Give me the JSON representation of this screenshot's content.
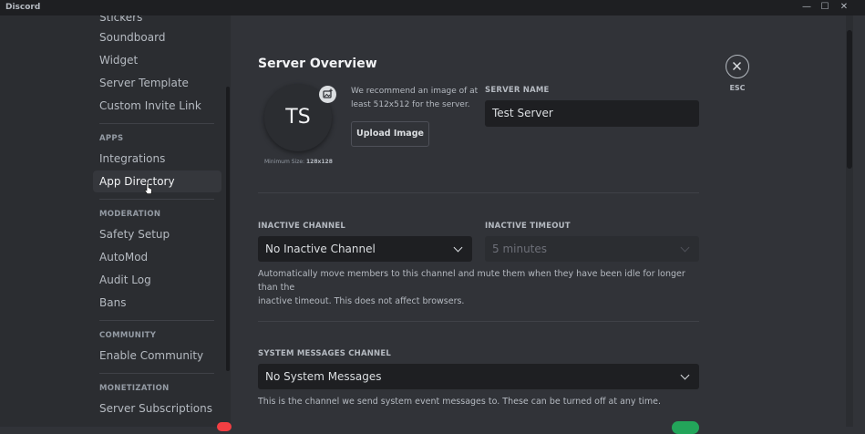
{
  "window": {
    "app_name": "Discord",
    "controls": {
      "minimize": "—",
      "maximize": "☐",
      "close": "✕"
    }
  },
  "sidebar": {
    "items_top": [
      {
        "label": "Stickers"
      },
      {
        "label": "Soundboard"
      },
      {
        "label": "Widget"
      },
      {
        "label": "Server Template"
      },
      {
        "label": "Custom Invite Link"
      }
    ],
    "apps_header": "APPS",
    "apps_items": [
      {
        "label": "Integrations"
      },
      {
        "label": "App Directory",
        "active": true
      }
    ],
    "moderation_header": "MODERATION",
    "moderation_items": [
      {
        "label": "Safety Setup"
      },
      {
        "label": "AutoMod"
      },
      {
        "label": "Audit Log"
      },
      {
        "label": "Bans"
      }
    ],
    "community_header": "COMMUNITY",
    "community_items": [
      {
        "label": "Enable Community"
      }
    ],
    "monetization_header": "MONETIZATION",
    "monetization_items": [
      {
        "label": "Server Subscriptions"
      }
    ]
  },
  "overview": {
    "title": "Server Overview",
    "icon_initials": "TS",
    "min_size_prefix": "Minimum Size: ",
    "min_size_value": "128x128",
    "recommend_text_1": "We recommend an image of at",
    "recommend_text_2": "least 512x512 for the server.",
    "upload_button": "Upload Image",
    "server_name_label": "SERVER NAME",
    "server_name_value": "Test Server",
    "esc_label": "ESC"
  },
  "inactive": {
    "channel_label": "INACTIVE CHANNEL",
    "channel_value": "No Inactive Channel",
    "timeout_label": "INACTIVE TIMEOUT",
    "timeout_value": "5 minutes",
    "help_1": "Automatically move members to this channel and mute them when they have been idle for longer than the",
    "help_2": "inactive timeout. This does not affect browsers."
  },
  "system_messages": {
    "label": "SYSTEM MESSAGES CHANNEL",
    "value": "No System Messages",
    "help": "This is the channel we send system event messages to. These can be turned off at any time."
  },
  "colors": {
    "bg_main": "#313338",
    "bg_sidebar": "#2b2d31",
    "bg_input": "#1e1f22",
    "toggle_green": "#23a55a",
    "notification_red": "#f23f43"
  }
}
